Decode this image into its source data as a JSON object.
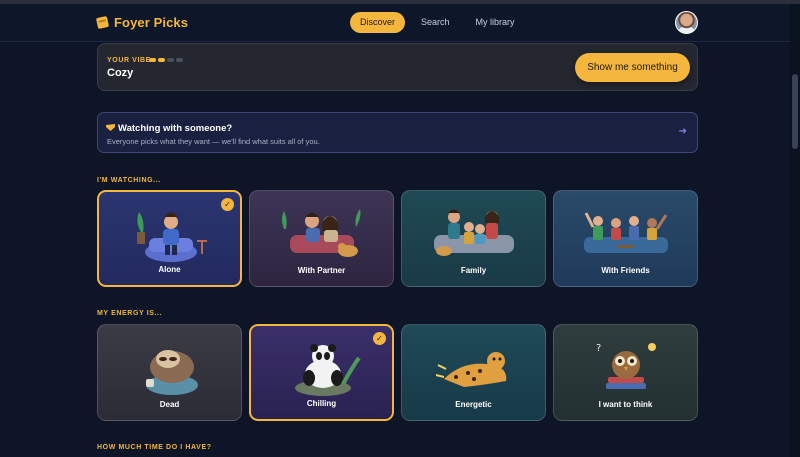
{
  "brand": {
    "name": "Foyer Picks"
  },
  "nav": {
    "tabs": [
      {
        "label": "Discover",
        "active": true
      },
      {
        "label": "Search",
        "active": false
      },
      {
        "label": "My library",
        "active": false
      }
    ]
  },
  "vibe": {
    "label": "YOUR VIBE",
    "value": "Cozy",
    "level_filled": 2,
    "level_total": 4,
    "cta_label": "Show me something"
  },
  "together": {
    "title": "Watching with someone?",
    "subtitle": "Everyone picks what they want — we'll find what suits all of you."
  },
  "watching": {
    "title": "I'M WATCHING...",
    "options": [
      {
        "label": "Alone",
        "selected": true,
        "icon": "person-on-couch-illustration"
      },
      {
        "label": "With Partner",
        "selected": false,
        "icon": "couple-with-dog-illustration"
      },
      {
        "label": "Family",
        "selected": false,
        "icon": "family-on-couch-illustration"
      },
      {
        "label": "With Friends",
        "selected": false,
        "icon": "friends-cheering-illustration"
      }
    ]
  },
  "energy": {
    "title": "MY ENERGY IS...",
    "options": [
      {
        "label": "Dead",
        "selected": false,
        "icon": "sloth-illustration"
      },
      {
        "label": "Chilling",
        "selected": true,
        "icon": "panda-illustration"
      },
      {
        "label": "Energetic",
        "selected": false,
        "icon": "cheetah-illustration"
      },
      {
        "label": "I want to think",
        "selected": false,
        "icon": "owl-illustration"
      }
    ]
  },
  "time": {
    "title": "HOW MUCH TIME DO I HAVE?"
  },
  "colors": {
    "accent": "#f4b63d",
    "background": "#0d1526",
    "link_arrow": "#8e7ff0"
  },
  "check_glyph": "✓",
  "arrow_glyph": "➔"
}
